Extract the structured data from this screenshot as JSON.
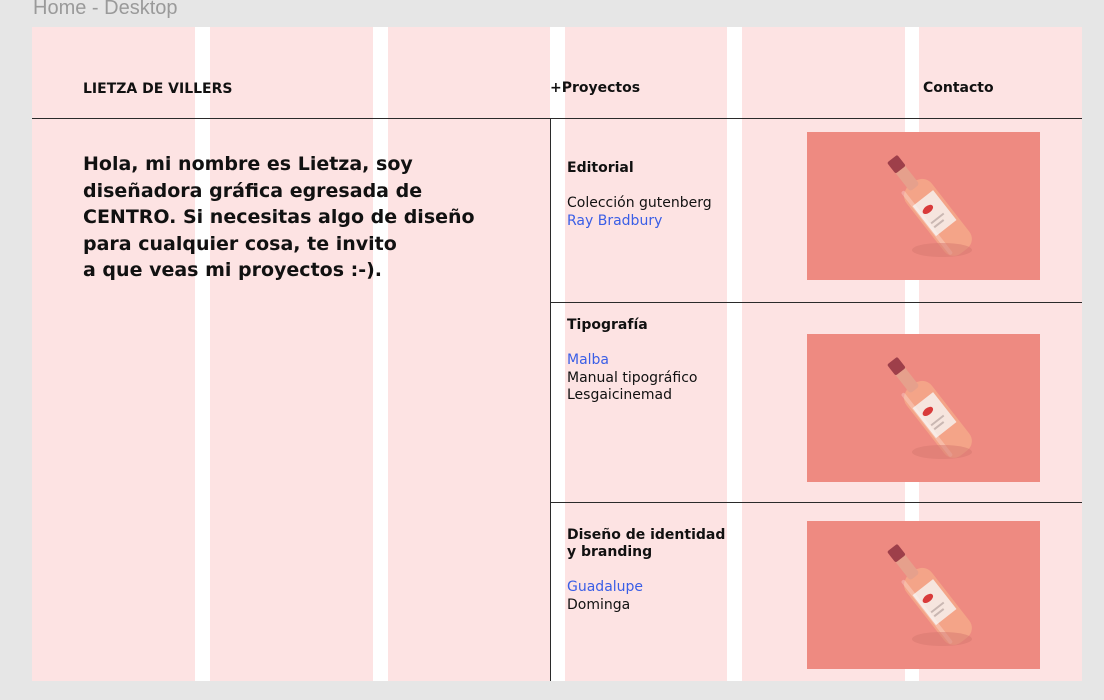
{
  "frame_label": "Home - Desktop",
  "header": {
    "brand": "LIETZA DE VILLERS",
    "projects_link": "+Proyectos",
    "contact_link": "Contacto"
  },
  "intro": "Hola, mi nombre es Lietza, soy\ndiseñadora gráfica egresada de\nCENTRO. Si necesitas algo de diseño\npara cualquier cosa, te invito\na que veas mi proyectos :-).",
  "sections": [
    {
      "title": "Editorial",
      "items": [
        {
          "label": "Colección gutenberg",
          "style": "dark"
        },
        {
          "label": "Ray Bradbury",
          "style": "blue"
        }
      ],
      "image": "wine-bottle-mockup"
    },
    {
      "title": "Tipografía",
      "items": [
        {
          "label": "Malba",
          "style": "blue"
        },
        {
          "label": "Manual tipográfico",
          "style": "dark"
        },
        {
          "label": "Lesgaicinemad",
          "style": "dark"
        }
      ],
      "image": "wine-bottle-mockup"
    },
    {
      "title": "Diseño de identidad\ny branding",
      "items": [
        {
          "label": "Guadalupe",
          "style": "blue"
        },
        {
          "label": "Dominga",
          "style": "dark"
        }
      ],
      "image": "wine-bottle-mockup"
    }
  ],
  "colors": {
    "frame_bg": "#fde3e3",
    "link_blue": "#3a5ee6",
    "thumb_bg": "#ee8a81"
  }
}
